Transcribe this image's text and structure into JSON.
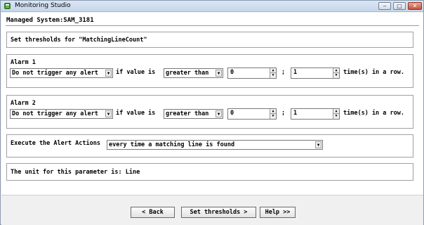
{
  "window": {
    "title": "Monitoring Studio",
    "icon": "monitoring-studio-icon",
    "controls": {
      "minimize": "‒",
      "maximize": "□",
      "close": "✕"
    }
  },
  "managed_system": "Managed System:SAM_3181",
  "thresholds_title": "Set thresholds for \"MatchingLineCount\"",
  "alarm1": {
    "title": "Alarm 1",
    "action": "Do not trigger any alert",
    "if_value_is": "if value is",
    "operator": "greater than",
    "value": "0",
    "separator": ";",
    "count": "1",
    "suffix": "time(s) in a row."
  },
  "alarm2": {
    "title": "Alarm 2",
    "action": "Do not trigger any alert",
    "if_value_is": "if value is",
    "operator": "greater than",
    "value": "0",
    "separator": ";",
    "count": "1",
    "suffix": "time(s) in a row."
  },
  "alert_actions": {
    "label": "Execute the Alert Actions",
    "value": "every time a matching line is found"
  },
  "unit": "The unit for this parameter is: Line",
  "buttons": {
    "back": "< Back",
    "set_thresholds": "Set thresholds >",
    "help": "Help >>"
  }
}
